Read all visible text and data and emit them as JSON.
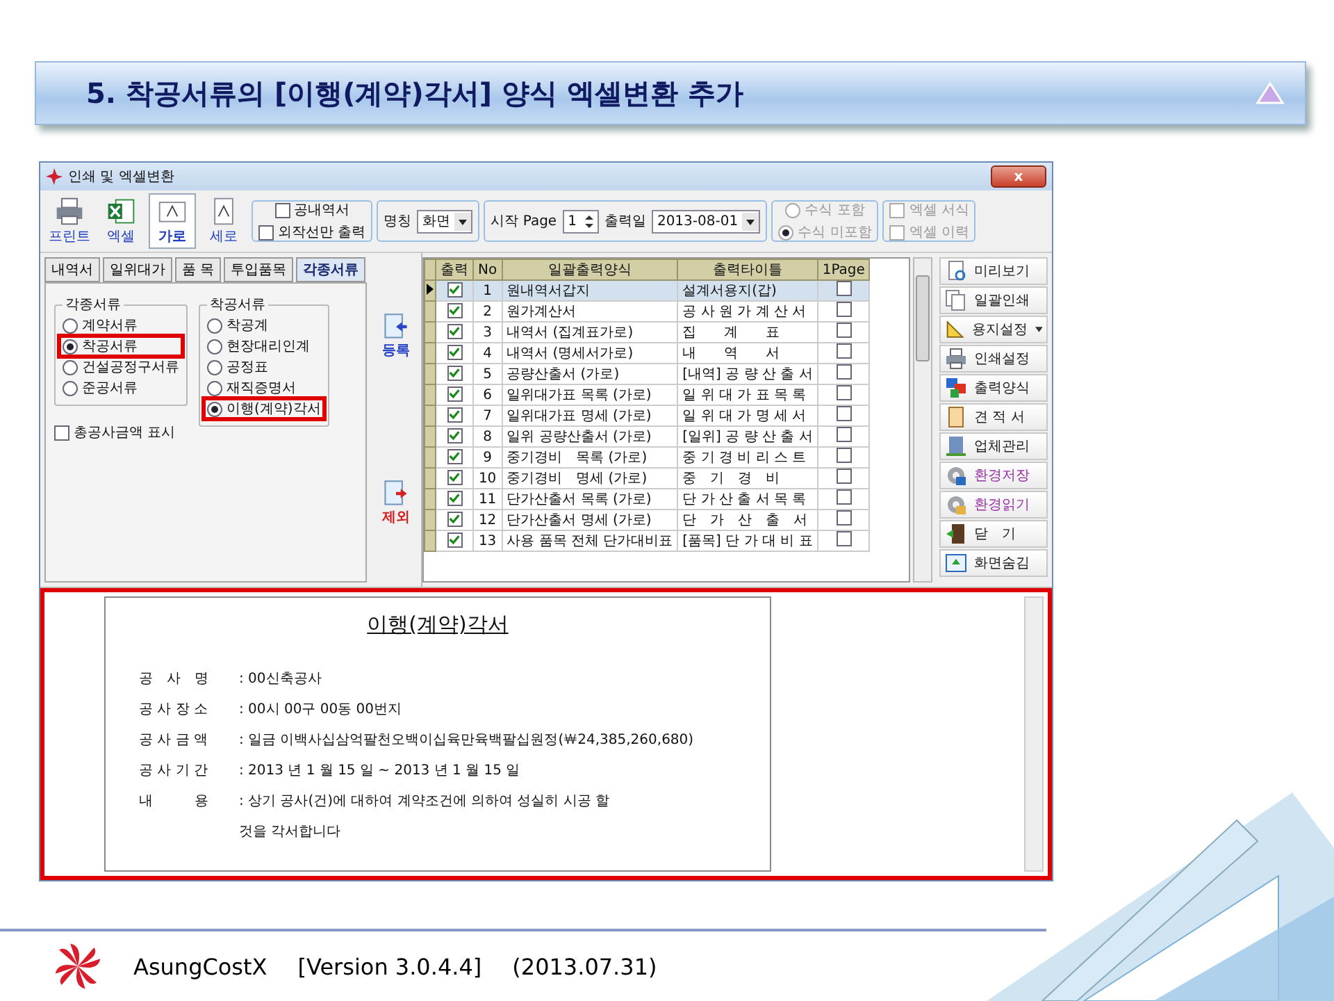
{
  "slide": {
    "title": "5. 착공서류의 [이행(계약)각서] 양식 엑셀변환 추가",
    "footer": {
      "product": "AsungCostX",
      "version": "[Version 3.0.4.4]",
      "date": "(2013.07.31)"
    }
  },
  "window": {
    "title": "인쇄 및 엑셀변환",
    "close": "x"
  },
  "toolbar": {
    "buttons": [
      {
        "label": "프린트",
        "selected": false
      },
      {
        "label": "엑셀",
        "selected": false
      },
      {
        "label": "가로",
        "selected": true
      },
      {
        "label": "세로",
        "selected": false
      }
    ],
    "options": [
      {
        "label": "공내역서",
        "checked": false
      },
      {
        "label": "외작선만 출력",
        "checked": false
      }
    ],
    "paper": {
      "label": "명칭",
      "value": "화면"
    },
    "start_page": {
      "label": "시작 Page",
      "value": "1"
    },
    "print_date": {
      "label": "출력일",
      "value": "2013-08-01"
    },
    "formula": [
      {
        "label": "수식 포함",
        "selected": false,
        "disabled": true
      },
      {
        "label": "수식 미포함",
        "selected": true,
        "disabled": true
      }
    ],
    "excel": [
      {
        "label": "엑셀 서식",
        "checked": false,
        "disabled": true
      },
      {
        "label": "엑셀 이력",
        "checked": false,
        "disabled": true
      }
    ]
  },
  "tabs": [
    {
      "label": "내역서",
      "selected": false
    },
    {
      "label": "일위대가",
      "selected": false
    },
    {
      "label": "품 목",
      "selected": false
    },
    {
      "label": "투입품목",
      "selected": false
    },
    {
      "label": "각종서류",
      "selected": true
    }
  ],
  "doc_groups": [
    {
      "title": "각종서류",
      "items": [
        {
          "label": "계약서류",
          "selected": false,
          "highlighted": false
        },
        {
          "label": "착공서류",
          "selected": true,
          "highlighted": true
        },
        {
          "label": "건설공정구서류",
          "selected": false,
          "highlighted": false
        },
        {
          "label": "준공서류",
          "selected": false,
          "highlighted": false
        }
      ]
    },
    {
      "title": "착공서류",
      "items": [
        {
          "label": "착공계",
          "selected": false,
          "highlighted": false
        },
        {
          "label": "현장대리인계",
          "selected": false,
          "highlighted": false
        },
        {
          "label": "공정표",
          "selected": false,
          "highlighted": false
        },
        {
          "label": "재직증명서",
          "selected": false,
          "highlighted": false
        },
        {
          "label": "이행(계약)각서",
          "selected": true,
          "highlighted": true
        }
      ]
    }
  ],
  "show_total": {
    "label": "총공사금액 표시",
    "checked": false
  },
  "actions": [
    {
      "label": "등록",
      "color": "#2a46c8"
    },
    {
      "label": "제외",
      "color": "#d42020"
    }
  ],
  "grid": {
    "columns": [
      "출력",
      "No",
      "일괄출력양식",
      "출력타이틀",
      "1Page"
    ],
    "rows": [
      {
        "print": true,
        "no": "1",
        "form": "원내역서갑지",
        "title": "설계서용지(갑)",
        "one_page": false,
        "selected": true
      },
      {
        "print": true,
        "no": "2",
        "form": "원가계산서",
        "title": "공 사 원 가 계 산 서",
        "one_page": false,
        "selected": false
      },
      {
        "print": true,
        "no": "3",
        "form": "내역서 (집계표가로)",
        "title": "집　　계　　표",
        "one_page": false,
        "selected": false
      },
      {
        "print": true,
        "no": "4",
        "form": "내역서 (명세서가로)",
        "title": "내　　역　　서",
        "one_page": false,
        "selected": false
      },
      {
        "print": true,
        "no": "5",
        "form": "공량산출서 (가로)",
        "title": "[내역] 공 량 산 출 서",
        "one_page": false,
        "selected": false
      },
      {
        "print": true,
        "no": "6",
        "form": "일위대가표 목록 (가로)",
        "title": "일 위 대 가 표 목 록",
        "one_page": false,
        "selected": false
      },
      {
        "print": true,
        "no": "7",
        "form": "일위대가표 명세 (가로)",
        "title": "일 위 대 가 명 세 서",
        "one_page": false,
        "selected": false
      },
      {
        "print": true,
        "no": "8",
        "form": "일위 공량산출서 (가로)",
        "title": "[일위] 공 량 산 출 서",
        "one_page": false,
        "selected": false
      },
      {
        "print": true,
        "no": "9",
        "form": "중기경비　목록 (가로)",
        "title": "중 기 경 비 리 스 트",
        "one_page": false,
        "selected": false
      },
      {
        "print": true,
        "no": "10",
        "form": "중기경비　명세 (가로)",
        "title": "중　기　경　비",
        "one_page": false,
        "selected": false
      },
      {
        "print": true,
        "no": "11",
        "form": "단가산출서 목록 (가로)",
        "title": "단 가 산 출 서 목 록",
        "one_page": false,
        "selected": false
      },
      {
        "print": true,
        "no": "12",
        "form": "단가산출서 명세 (가로)",
        "title": "단　가　산　출　서",
        "one_page": false,
        "selected": false
      },
      {
        "print": true,
        "no": "13",
        "form": "사용 품목 전체 단가대비표",
        "title": "[품목] 단 가 대 비 표",
        "one_page": false,
        "selected": false
      }
    ]
  },
  "side_buttons": [
    {
      "label": "미리보기",
      "color": "#202020",
      "menu": false
    },
    {
      "label": "일괄인쇄",
      "color": "#202020",
      "menu": false
    },
    {
      "label": "용지설정",
      "color": "#202020",
      "menu": true
    },
    {
      "label": "인쇄설정",
      "color": "#202020",
      "menu": false
    },
    {
      "label": "출력양식",
      "color": "#202020",
      "menu": false
    },
    {
      "label": "견 적 서",
      "color": "#202020",
      "menu": false
    },
    {
      "label": "업체관리",
      "color": "#202020",
      "menu": false
    },
    {
      "label": "환경저장",
      "color": "#9a2fa8",
      "menu": false
    },
    {
      "label": "환경읽기",
      "color": "#9a2fa8",
      "menu": false
    },
    {
      "label": "닫　기",
      "color": "#202020",
      "menu": false
    },
    {
      "label": "화면숨김",
      "color": "#202020",
      "menu": false
    }
  ],
  "preview": {
    "highlighted": true,
    "title": "이행(계약)각서",
    "fields": [
      {
        "label": "공　사　명",
        "value": ": 00신축공사"
      },
      {
        "label": "공 사 장 소",
        "value": ": 00시 00구 00동 00번지"
      },
      {
        "label": "공 사 금 액",
        "value": ": 일금 이백사십삼억팔천오백이십육만육백팔십원정(￦24,385,260,680)"
      },
      {
        "label": "공 사 기 간",
        "value": ": 2013 년 1 월 15 일 ~ 2013 년 1 월 15 일"
      },
      {
        "label": "내　　　용",
        "value": ": 상기 공사(건)에 대하여 계약조건에 의하여 성실히 시공 할"
      }
    ],
    "continuation": "것을 각서합니다"
  }
}
